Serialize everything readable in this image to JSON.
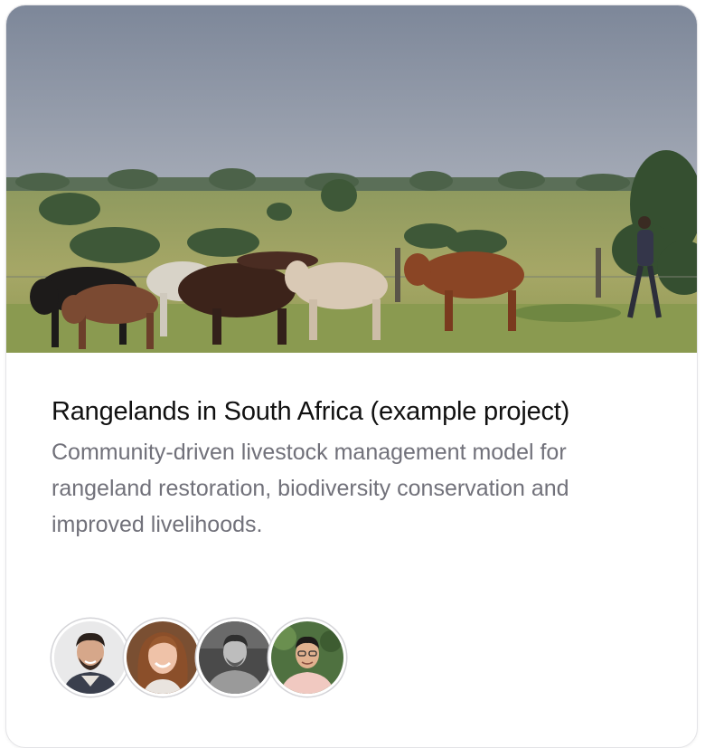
{
  "project": {
    "title": "Rangelands in South Africa (example project)",
    "description": "Community-driven livestock management model for rangeland restoration, biodiversity conservation and improved livelihoods."
  },
  "hero": {
    "icon": "photo-cattle-herd",
    "colors": {
      "sky": "#8a94a4",
      "grass": "#a0a463",
      "trees": "#3f5b3a"
    }
  },
  "members": [
    {
      "icon": "avatar-man-smiling-beard"
    },
    {
      "icon": "avatar-woman-smiling"
    },
    {
      "icon": "avatar-man-bw"
    },
    {
      "icon": "avatar-man-glasses-greenery"
    }
  ],
  "colors": {
    "title": "#111111",
    "description": "#71717a",
    "border": "#e4e4e7"
  }
}
